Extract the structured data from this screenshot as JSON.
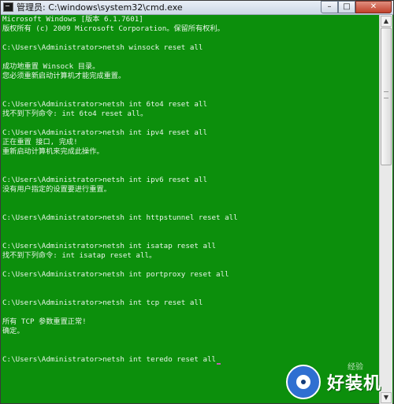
{
  "window": {
    "title": "管理员: C:\\windows\\system32\\cmd.exe",
    "minimize_glyph": "–",
    "maximize_glyph": "□",
    "close_glyph": "✕"
  },
  "console": {
    "lines": [
      "Microsoft Windows [版本 6.1.7601]",
      "版权所有 (c) 2009 Microsoft Corporation。保留所有权利。",
      "",
      "C:\\Users\\Administrator>netsh winsock reset all",
      "",
      "成功地重置 Winsock 目录。",
      "您必须重新启动计算机才能完成重置。",
      "",
      "",
      "C:\\Users\\Administrator>netsh int 6to4 reset all",
      "找不到下列命令: int 6to4 reset all。",
      "",
      "C:\\Users\\Administrator>netsh int ipv4 reset all",
      "正在重置 接口, 完成!",
      "重新启动计算机来完成此操作。",
      "",
      "",
      "C:\\Users\\Administrator>netsh int ipv6 reset all",
      "没有用户指定的设置要进行重置。",
      "",
      "",
      "C:\\Users\\Administrator>netsh int httpstunnel reset all",
      "",
      "",
      "C:\\Users\\Administrator>netsh int isatap reset all",
      "找不到下列命令: int isatap reset all。",
      "",
      "C:\\Users\\Administrator>netsh int portproxy reset all",
      "",
      "",
      "C:\\Users\\Administrator>netsh int tcp reset all",
      "",
      "所有 TCP 参数重置正常!",
      "确定。",
      "",
      "",
      "C:\\Users\\Administrator>netsh int teredo reset all"
    ]
  },
  "scrollbar": {
    "up_glyph": "▲",
    "down_glyph": "▼"
  },
  "watermark": {
    "text": "好装机",
    "small_text": "经验"
  },
  "colors": {
    "console_background": "#0c8f0c",
    "console_text": "#e9f5e9"
  }
}
